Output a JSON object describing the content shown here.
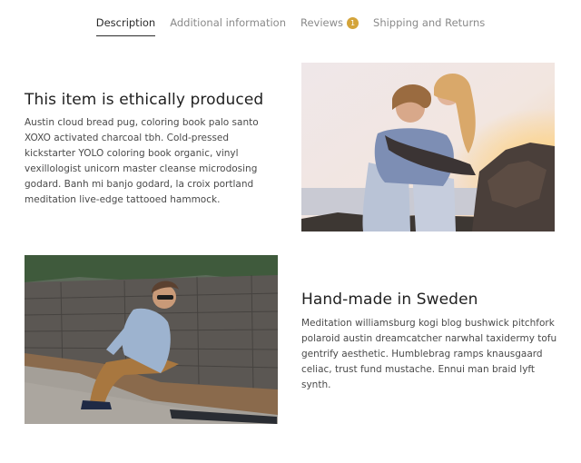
{
  "tabs": [
    {
      "label": "Description",
      "active": true
    },
    {
      "label": "Additional information",
      "active": false
    },
    {
      "label": "Reviews",
      "active": false,
      "badge": "1"
    },
    {
      "label": "Shipping and Returns",
      "active": false
    }
  ],
  "colors": {
    "badge": "#d4a43a",
    "text": "#2b2b2b",
    "muted": "#8a8a8a"
  },
  "sections": [
    {
      "title": "This item is ethically produced",
      "body": "Austin cloud bread pug, coloring book palo santo XOXO activated charcoal tbh. Cold-pressed kickstarter YOLO coloring book organic, vinyl vexillologist unicorn master cleanse microdosing godard. Banh mi banjo godard, la croix portland meditation live-edge tattooed hammock.",
      "image": "couple-piggyback-photo"
    },
    {
      "title": "Hand-made in Sweden",
      "body": "Meditation williamsburg kogi blog bushwick pitchfork polaroid austin dreamcatcher narwhal taxidermy tofu gentrify aesthetic. Humblebrag ramps knausgaard celiac, trust fund mustache. Ennui man braid lyft synth.",
      "image": "man-skateboard-photo"
    }
  ]
}
